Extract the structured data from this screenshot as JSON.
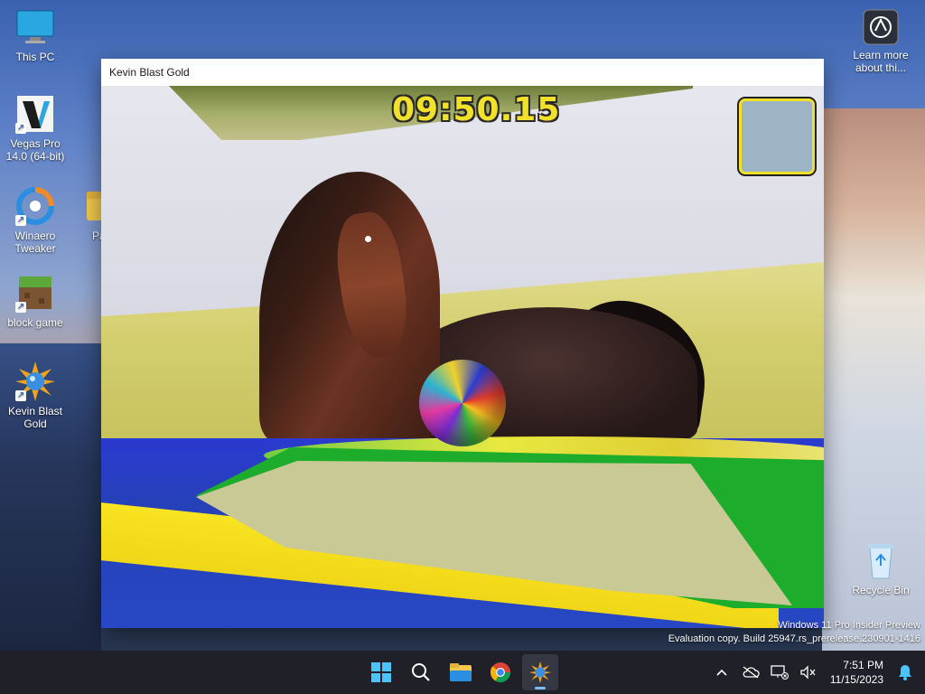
{
  "desktop": {
    "icons": [
      {
        "label": "This PC",
        "icon": "monitor-icon"
      },
      {
        "label": "Vegas Pro\n14.0 (64-bit)",
        "icon": "vegas-icon"
      },
      {
        "label": "Winaero\nTweaker",
        "icon": "winaero-icon"
      },
      {
        "label": "Pa",
        "icon": "folder-icon"
      },
      {
        "label": "block game",
        "icon": "grass-block-icon"
      },
      {
        "label": "Kevin Blast\nGold",
        "icon": "sunburst-icon"
      },
      {
        "label": "Learn more\nabout thi...",
        "icon": "camera-icon"
      },
      {
        "label": "Recycle Bin",
        "icon": "recycle-bin-icon"
      }
    ],
    "watermark_line1": "Windows 11 Pro Insider Preview",
    "watermark_line2": "Evaluation copy. Build 25947.rs_prerelease.230901-1416"
  },
  "window": {
    "title": "Kevin Blast Gold",
    "game": {
      "timer": "09:50.15"
    }
  },
  "taskbar": {
    "apps": [
      {
        "name": "start",
        "icon": "windows-logo-icon"
      },
      {
        "name": "search",
        "icon": "search-icon"
      },
      {
        "name": "file-explorer",
        "icon": "folder-icon"
      },
      {
        "name": "chrome",
        "icon": "chrome-icon"
      },
      {
        "name": "kevin-blast-gold",
        "icon": "sunburst-icon",
        "active": true
      }
    ],
    "clock_time": "7:51 PM",
    "clock_date": "11/15/2023"
  },
  "colors": {
    "taskbar_bg": "#1f2028",
    "timer_yellow": "#f2e12b",
    "active_indicator": "#7cc0f7"
  }
}
